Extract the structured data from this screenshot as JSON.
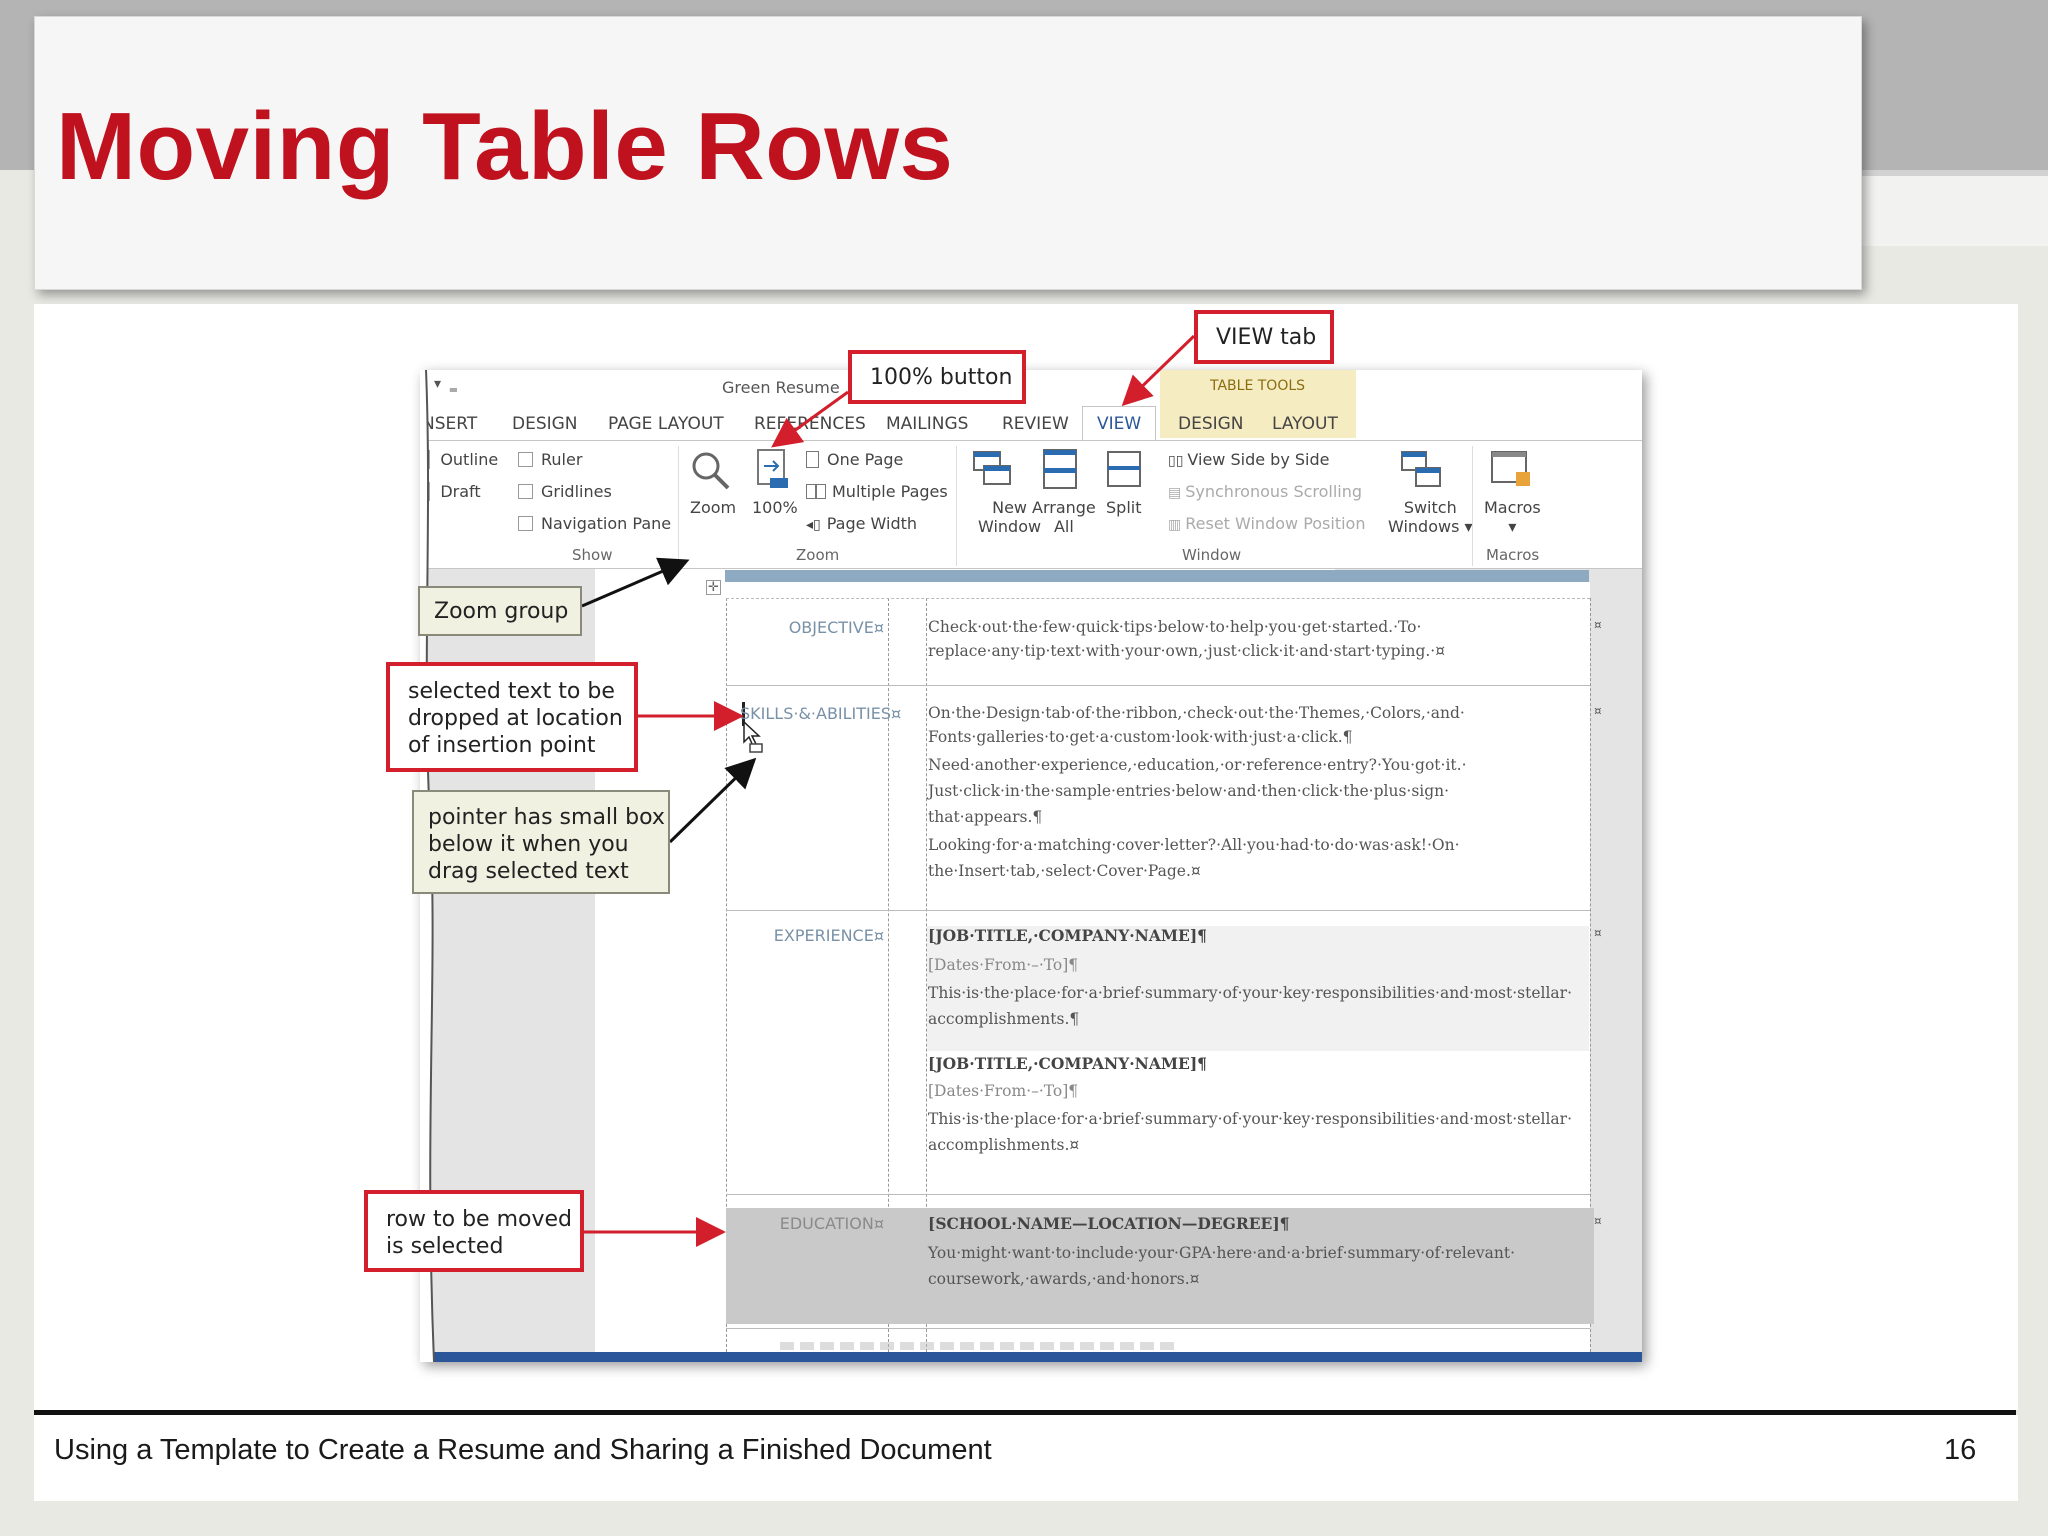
{
  "slide": {
    "title": "Moving Table Rows",
    "footer": "Using a Template to Create a Resume and Sharing a Finished Document",
    "page_number": "16"
  },
  "word": {
    "doc_title": "Green Resume",
    "tabs": [
      "NSERT",
      "DESIGN",
      "PAGE LAYOUT",
      "REFERENCES",
      "MAILINGS",
      "REVIEW",
      "VIEW"
    ],
    "table_tools": {
      "header": "TABLE TOOLS",
      "tabs": [
        "DESIGN",
        "LAYOUT"
      ]
    },
    "active_tab": "VIEW",
    "show_group": {
      "views": [
        "Outline",
        "Draft"
      ],
      "checks": [
        "Ruler",
        "Gridlines",
        "Navigation Pane"
      ],
      "label": "Show"
    },
    "zoom_group": {
      "zoom": "Zoom",
      "hundred": "100%",
      "one_page": "One Page",
      "multiple_pages": "Multiple Pages",
      "page_width": "Page Width",
      "label": "Zoom"
    },
    "window_group": {
      "new_window": [
        "New",
        "Window"
      ],
      "arrange_all": [
        "Arrange",
        "All"
      ],
      "split": "Split",
      "view_side_by_side": "View Side by Side",
      "synchronous_scrolling": "Synchronous Scrolling",
      "reset_window_position": "Reset Window Position",
      "switch_windows": [
        "Switch",
        "Windows ▾"
      ],
      "label": "Window"
    },
    "macros_group": {
      "macros": "Macros",
      "label": "Macros"
    }
  },
  "document": {
    "objective": {
      "label": "OBJECTIVE¤",
      "lines": [
        "Check·out·the·few·quick·tips·below·to·help·you·get·started.·To·",
        "replace·any·tip·text·with·your·own,·just·click·it·and·start·typing.·¤"
      ]
    },
    "skills": {
      "label": "SKILLS·&·ABILITIES¤",
      "lines": [
        "On·the·Design·tab·of·the·ribbon,·check·out·the·Themes,·Colors,·and·",
        "Fonts·galleries·to·get·a·custom·look·with·just·a·click.¶",
        "Need·another·experience,·education,·or·reference·entry?·You·got·it.·",
        "Just·click·in·the·sample·entries·below·and·then·click·the·plus·sign·",
        "that·appears.¶",
        "Looking·for·a·matching·cover·letter?·All·you·had·to·do·was·ask!·On·",
        "the·Insert·tab,·select·Cover·Page.¤"
      ]
    },
    "experience": {
      "label": "EXPERIENCE¤",
      "job1": [
        "[JOB·TITLE,·COMPANY·NAME]¶",
        "[Dates·From·–·To]¶",
        "This·is·the·place·for·a·brief·summary·of·your·key·responsibilities·and·most·stellar·",
        "accomplishments.¶"
      ],
      "job2": [
        "[JOB·TITLE,·COMPANY·NAME]¶",
        "[Dates·From·–·To]¶",
        "This·is·the·place·for·a·brief·summary·of·your·key·responsibilities·and·most·stellar·",
        "accomplishments.¤"
      ]
    },
    "education": {
      "label": "EDUCATION¤",
      "lines": [
        "[SCHOOL·NAME—LOCATION—DEGREE]¶",
        "You·might·want·to·include·your·GPA·here·and·a·brief·summary·of·relevant·",
        "coursework,·awards,·and·honors.¤"
      ]
    },
    "end_mark": "¤"
  },
  "callouts": {
    "hundred_button": "100% button",
    "view_tab": "VIEW tab",
    "zoom_group": "Zoom group",
    "selected_text": [
      "selected text to be",
      "dropped at location",
      "of insertion point"
    ],
    "pointer": [
      "pointer has small box",
      "below it when you",
      "drag selected text"
    ],
    "row_moved": [
      "row to be moved",
      "is selected"
    ]
  },
  "colors": {
    "title_red": "#c0111e",
    "callout_red": "#d21f2b",
    "table_tools": "#f6ecc2",
    "doc_header_bar": "#8eaac2"
  }
}
